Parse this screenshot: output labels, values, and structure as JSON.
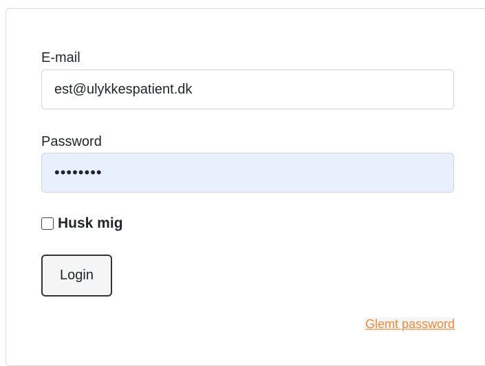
{
  "form": {
    "email_label": "E-mail",
    "email_value": "est@ulykkespatient.dk",
    "password_label": "Password",
    "password_value": "••••••••",
    "remember_label": "Husk mig",
    "remember_checked": false,
    "login_label": "Login",
    "forgot_label": "Glemt password"
  },
  "colors": {
    "link": "#f08a3c",
    "autofill_background": "#e8f0fe"
  }
}
